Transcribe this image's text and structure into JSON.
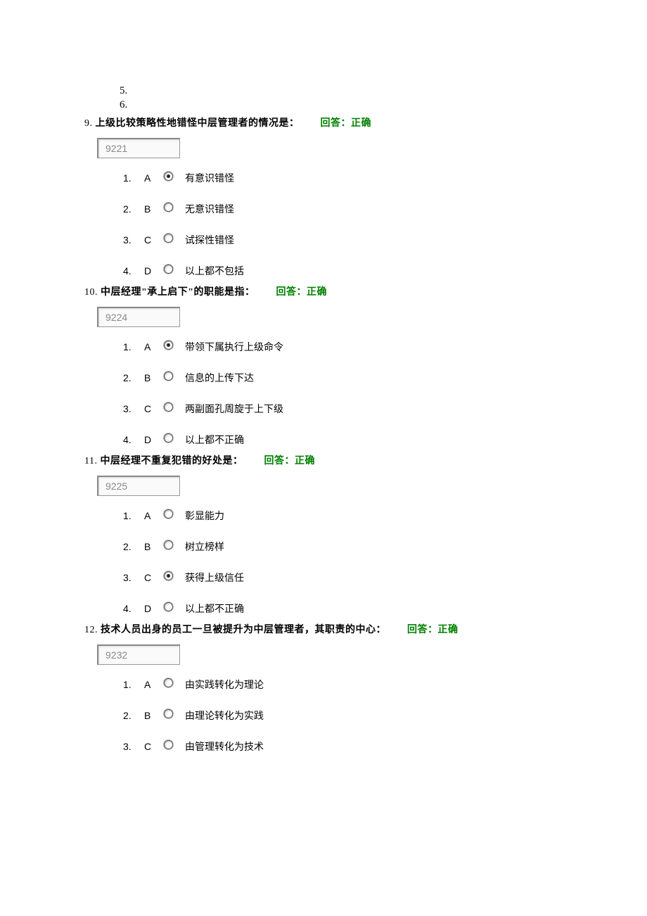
{
  "leading": [
    "5.",
    "6."
  ],
  "questions": [
    {
      "num": "9.",
      "text": "上级比较策略性地错怪中层管理者的情况是：",
      "status": "回答：正确",
      "id": "9221",
      "selected": 0,
      "options": [
        {
          "n": "1.",
          "letter": "A",
          "text": "有意识错怪"
        },
        {
          "n": "2.",
          "letter": "B",
          "text": "无意识错怪"
        },
        {
          "n": "3.",
          "letter": "C",
          "text": "试探性错怪"
        },
        {
          "n": "4.",
          "letter": "D",
          "text": "以上都不包括"
        }
      ]
    },
    {
      "num": "10.",
      "text": "中层经理\"承上启下\"的职能是指：",
      "status": "回答：正确",
      "id": "9224",
      "selected": 0,
      "options": [
        {
          "n": "1.",
          "letter": "A",
          "text": "带领下属执行上级命令"
        },
        {
          "n": "2.",
          "letter": "B",
          "text": "信息的上传下达"
        },
        {
          "n": "3.",
          "letter": "C",
          "text": "两副面孔周旋于上下级"
        },
        {
          "n": "4.",
          "letter": "D",
          "text": "以上都不正确"
        }
      ]
    },
    {
      "num": "11.",
      "text": "中层经理不重复犯错的好处是：",
      "status": "回答：正确",
      "id": "9225",
      "selected": 2,
      "options": [
        {
          "n": "1.",
          "letter": "A",
          "text": "彰显能力"
        },
        {
          "n": "2.",
          "letter": "B",
          "text": "树立榜样"
        },
        {
          "n": "3.",
          "letter": "C",
          "text": "获得上级信任"
        },
        {
          "n": "4.",
          "letter": "D",
          "text": "以上都不正确"
        }
      ]
    },
    {
      "num": "12.",
      "text": "技术人员出身的员工一旦被提升为中层管理者，其职责的中心：",
      "status": "回答：正确",
      "id": "9232",
      "selected": -1,
      "options": [
        {
          "n": "1.",
          "letter": "A",
          "text": "由实践转化为理论"
        },
        {
          "n": "2.",
          "letter": "B",
          "text": "由理论转化为实践"
        },
        {
          "n": "3.",
          "letter": "C",
          "text": "由管理转化为技术"
        }
      ]
    }
  ]
}
